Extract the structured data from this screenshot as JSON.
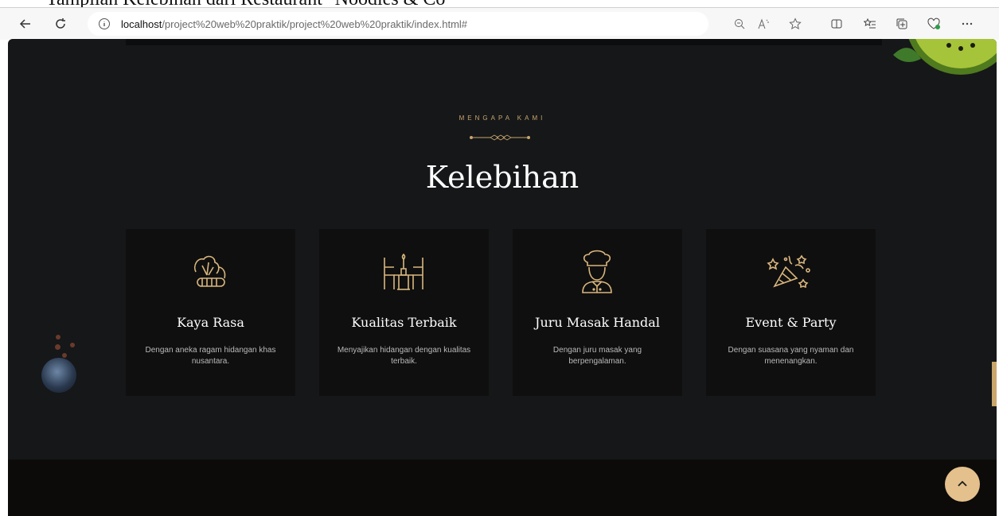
{
  "document_caption": "Tampilan Kelebihan dari Restaurant \"Noodles & Co\"",
  "browser": {
    "url_host": "localhost",
    "url_path": "/project%20web%20praktik/project%20web%20praktik/index.html#",
    "icons": [
      "back-icon",
      "refresh-icon",
      "info-icon",
      "zoom-icon",
      "read-aloud-icon",
      "favorite-icon",
      "split-screen-icon",
      "favorites-list-icon",
      "collections-icon",
      "browser-essentials-icon",
      "more-icon"
    ]
  },
  "section": {
    "eyebrow": "MENGAPA KAMI",
    "title": "Kelebihan"
  },
  "cards": [
    {
      "title": "Kaya Rasa",
      "desc": "Dengan aneka ragam hidangan khas nusantara.",
      "icon": "vegetables-icon"
    },
    {
      "title": "Kualitas Terbaik",
      "desc": "Menyajikan hidangan dengan kualitas terbaik.",
      "icon": "dining-table-icon"
    },
    {
      "title": "Juru Masak Handal",
      "desc": "Dengan juru masak yang berpengalaman.",
      "icon": "chef-icon"
    },
    {
      "title": "Event & Party",
      "desc": "Dengan suasana yang nyaman dan menenangkan.",
      "icon": "party-popper-icon"
    }
  ],
  "colors": {
    "accent": "#c9a66b",
    "background": "#151719",
    "card": "#100f0f",
    "scroll_button": "#e4c08c"
  }
}
